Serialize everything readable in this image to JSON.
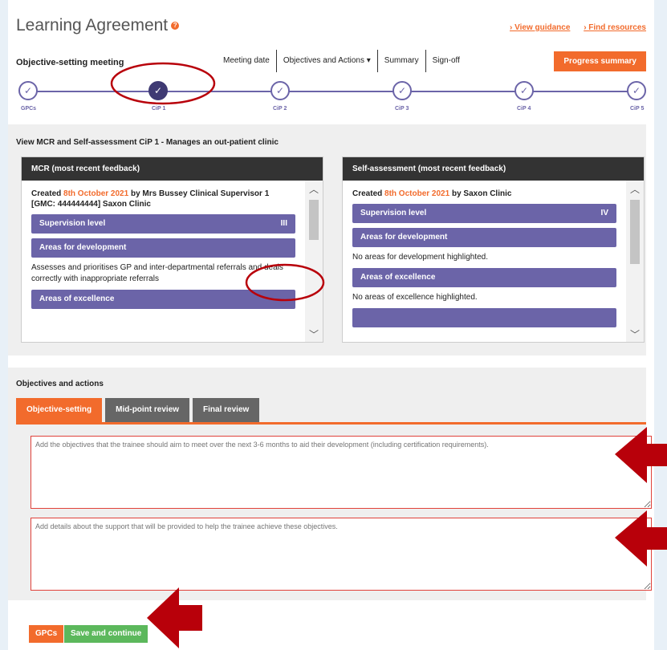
{
  "header": {
    "title": "Learning Agreement",
    "help_icon": "question-icon",
    "links": [
      "› View guidance",
      "› Find resources"
    ]
  },
  "meeting": {
    "label": "Objective-setting meeting",
    "nav": [
      "Meeting date",
      "Objectives and Actions ▾",
      "Summary",
      "Sign-off"
    ],
    "progress_button": "Progress summary"
  },
  "steps": [
    {
      "label": "GPCs",
      "state": "done"
    },
    {
      "label": "CiP 1",
      "state": "current"
    },
    {
      "label": "CiP 2",
      "state": "done"
    },
    {
      "label": "CiP 3",
      "state": "done"
    },
    {
      "label": "CiP 4",
      "state": "done"
    },
    {
      "label": "CiP 5",
      "state": "done"
    }
  ],
  "view": {
    "title": "View MCR and Self-assessment CiP 1 - Manages an out-patient clinic",
    "mcr": {
      "heading": "MCR (most recent feedback)",
      "created_prefix": "Created",
      "date": "8th October 2021",
      "created_suffix": "by Mrs Bussey Clinical Supervisor 1 [GMC: 444444444] Saxon Clinic",
      "supervision_label": "Supervision level",
      "supervision_value": "III",
      "dev_label": "Areas for development",
      "dev_text": "Assesses and prioritises GP and inter-departmental referrals and deals correctly with inappropriate referrals",
      "excellence_label": "Areas of excellence"
    },
    "self": {
      "heading": "Self-assessment (most recent feedback)",
      "created_prefix": "Created",
      "date": "8th October 2021",
      "created_suffix": "by Saxon Clinic",
      "supervision_label": "Supervision level",
      "supervision_value": "IV",
      "dev_label": "Areas for development",
      "dev_text": "No areas for development highlighted.",
      "excellence_label": "Areas of excellence",
      "excellence_text": "No areas of excellence highlighted."
    }
  },
  "objectives": {
    "title": "Objectives and actions",
    "tabs": [
      "Objective-setting",
      "Mid-point review",
      "Final review"
    ],
    "objectives_placeholder": "Add the objectives that the trainee should aim to meet over the next 3-6 months to aid their development (including certification requirements).",
    "support_placeholder": "Add details about the support that will be provided to help the trainee achieve these objectives."
  },
  "footer": {
    "gpcs_button": "GPCs",
    "save_button": "Save and continue"
  },
  "colors": {
    "accent": "#f26b2c",
    "purple": "#6b64a8",
    "annotation": "#b8000a"
  }
}
